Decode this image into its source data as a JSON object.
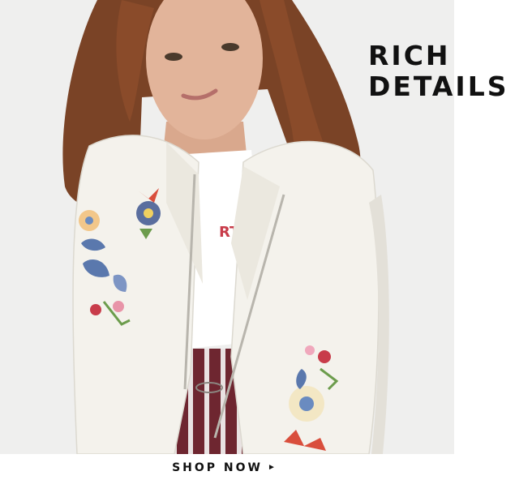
{
  "headline": {
    "line1": "RICH",
    "line2": "DETAILS"
  },
  "cta": {
    "label": "SHOP NOW",
    "arrow_icon": "play-triangle-icon",
    "arrow_glyph": "►"
  },
  "photo": {
    "subject": "model-photo",
    "colors": {
      "background": "#efefee",
      "jacket": "#f4f2ec",
      "hair": "#7a4326",
      "skin": "#e2b49a",
      "stripes": "#6e2630"
    }
  }
}
